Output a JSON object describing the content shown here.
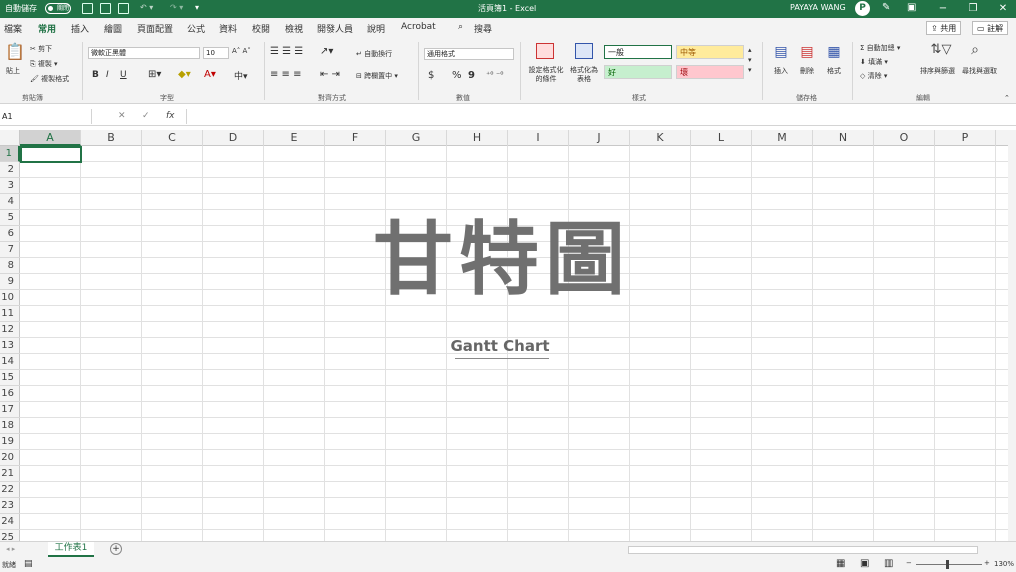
{
  "titlebar": {
    "autosave_label": "自動儲存",
    "autosave_state": "關閉",
    "doc_title": "活頁簿1 - Excel",
    "user_name": "PAYAYA WANG",
    "user_initial": "P",
    "minimize": "−",
    "restore": "❐",
    "close": "✕"
  },
  "ribbon_tabs": [
    "檔案",
    "常用",
    "插入",
    "繪圖",
    "頁面配置",
    "公式",
    "資料",
    "校閱",
    "檢視",
    "開發人員",
    "說明",
    "Acrobat"
  ],
  "search_label": "搜尋",
  "share_label": "共用",
  "comments_label": "註解",
  "clipboard": {
    "paste": "貼上",
    "cut": "剪下",
    "copy": "複製",
    "format_painter": "複製格式",
    "group": "剪貼簿"
  },
  "font": {
    "name": "微軟正黑體",
    "size": "10",
    "bold": "B",
    "italic": "I",
    "underline": "U",
    "group": "字型"
  },
  "alignment": {
    "wrap": "自動換行",
    "merge": "跨欄置中",
    "group": "對齊方式"
  },
  "number": {
    "format": "通用格式",
    "currency": "$",
    "percent": "%",
    "comma": "9",
    "group": "數值"
  },
  "styles": {
    "conditional": "設定格式化的條件",
    "table": "格式化為表格",
    "normal": "一般",
    "neutral": "中等",
    "good": "好",
    "bad": "壞",
    "group": "樣式"
  },
  "cells_group": {
    "insert": "插入",
    "delete": "刪除",
    "format": "格式",
    "group": "儲存格"
  },
  "editing": {
    "autosum": "自動加總",
    "fill": "填滿",
    "clear": "清除",
    "sort": "排序與篩選",
    "find": "尋找與選取",
    "group": "編輯"
  },
  "formula_bar": {
    "name_box": "A1",
    "fx": "fx",
    "cancel": "✕",
    "enter": "✓"
  },
  "columns": [
    "A",
    "B",
    "C",
    "D",
    "E",
    "F",
    "G",
    "H",
    "I",
    "J",
    "K",
    "L",
    "M",
    "N",
    "O",
    "P"
  ],
  "rows": [
    "1",
    "2",
    "3",
    "4",
    "5",
    "6",
    "7",
    "8",
    "9",
    "10",
    "11",
    "12",
    "13",
    "14",
    "15",
    "16",
    "17",
    "18",
    "19",
    "20",
    "21",
    "22",
    "23",
    "24",
    "25"
  ],
  "selected_cell": {
    "column": "A",
    "row": "1"
  },
  "overlay": {
    "title": "甘特圖",
    "subtitle": "Gantt Chart"
  },
  "sheet_tab": "工作表1",
  "add_sheet": "+",
  "status": {
    "mode": "就緒",
    "zoom": "130%",
    "zoom_minus": "−",
    "zoom_plus": "+"
  },
  "colors": {
    "accent": "#217346",
    "neutral_bg": "#ffeb9c",
    "neutral_fg": "#9c5700",
    "good_bg": "#c6efce",
    "good_fg": "#006100",
    "bad_bg": "#ffc7ce",
    "bad_fg": "#9c0006"
  }
}
